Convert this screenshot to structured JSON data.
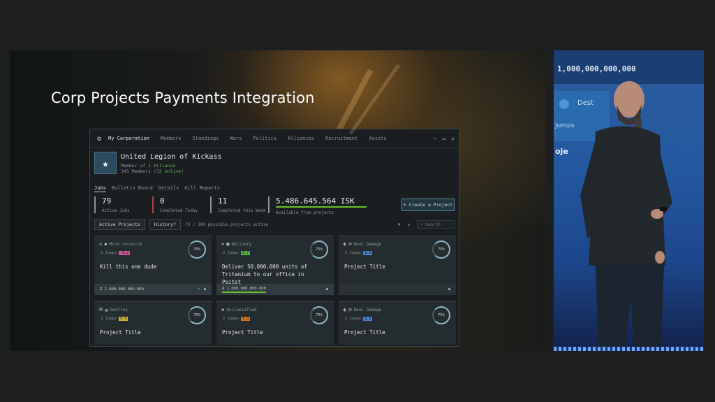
{
  "slide": {
    "title": "Corp Projects Payments Integration"
  },
  "window": {
    "nav": {
      "tabs": [
        "My Corporation",
        "Members",
        "Standings",
        "Wars",
        "Politics",
        "Alliances",
        "Recruitment",
        "Assets"
      ],
      "controls": [
        "–",
        "▭",
        "✕"
      ]
    },
    "corp": {
      "name": "United Legion of Kickass",
      "member_of_prefix": "Member of ",
      "member_of_count": "1 Alliance",
      "members_prefix": "345 Members (",
      "members_online": "32 online",
      "members_suffix": ")"
    },
    "subtabs": [
      "Jobs",
      "Bulletin Board",
      "Details",
      "Kill Reports"
    ],
    "stats": [
      {
        "value": "79",
        "label": "Active Jobs"
      },
      {
        "value": "0",
        "label": "Completed Today"
      },
      {
        "value": "11",
        "label": "Completed this Week"
      },
      {
        "value": "5.486.645.564 ISK",
        "label": "Available from projects"
      }
    ],
    "create_button": "+  Create a Project",
    "filters": {
      "active_projects": "Active Projects",
      "history": "History?",
      "count_text": "79 / 100 possible projects active",
      "search_placeholder": "Search"
    },
    "cards": [
      {
        "category": "Mine resource",
        "jumps": "2 Jumps",
        "sec": "-0.2",
        "sec_color": "#c65a9a",
        "title": "Kill this one dude",
        "progress": "75%",
        "amount": "1.000.000.000.000"
      },
      {
        "category": "Delivery",
        "jumps": "2 Jumps",
        "sec": "0.7",
        "sec_color": "#55b04a",
        "title": "Deliver 50,000,000 units of Tritanium to our office in Poitot",
        "progress": "75%",
        "amount": "1.000.000.000.000"
      },
      {
        "category": "Deal Damage",
        "jumps": "2 Jumps",
        "sec": "1.0",
        "sec_color": "#4a7fd0",
        "title": "Project Title",
        "progress": "75%",
        "amount": ""
      },
      {
        "category": "Destroy",
        "jumps": "2 Jumps",
        "sec": "0.5",
        "sec_color": "#c8b13a",
        "title": "Project Title",
        "progress": "75%",
        "amount": ""
      },
      {
        "category": "Unclassified",
        "jumps": "2 Jumps",
        "sec": "0.3",
        "sec_color": "#c87a2a",
        "title": "Project Title",
        "progress": "75%",
        "amount": ""
      },
      {
        "category": "Deal Damage",
        "jumps": "2 Jumps",
        "sec": "1.0",
        "sec_color": "#4a7fd0",
        "title": "Project Title",
        "progress": "75%",
        "amount": ""
      }
    ]
  },
  "stage_screen": {
    "number": "1,000,000,000,000",
    "text1": "Dest",
    "text2": "Jumps",
    "text3": "oje"
  },
  "colors": {
    "accent_green": "#67c02a",
    "stat_red": "#b64040",
    "stage_blue": "#2458a0"
  }
}
